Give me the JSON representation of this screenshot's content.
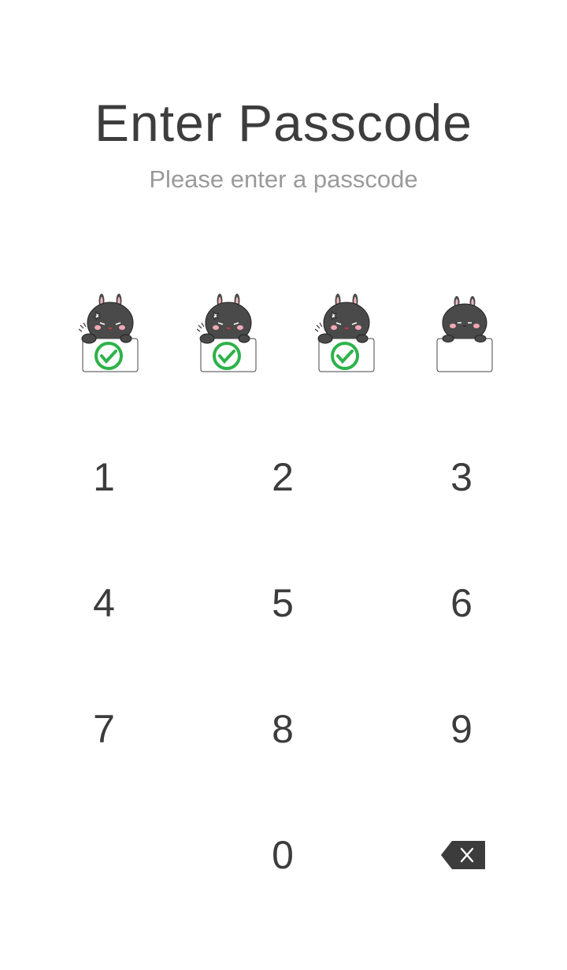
{
  "header": {
    "title": "Enter Passcode",
    "subtitle": "Please enter a passcode"
  },
  "passcode": {
    "length": 4,
    "entered": 3,
    "filled_icon": "bunny-holding-check-sign-icon",
    "empty_icon": "bunny-holding-blank-sign-icon",
    "check_color": "#2db24a"
  },
  "keypad": {
    "keys": [
      "1",
      "2",
      "3",
      "4",
      "5",
      "6",
      "7",
      "8",
      "9",
      "",
      "0",
      "backspace"
    ],
    "backspace_icon": "backspace-icon"
  },
  "colors": {
    "text": "#3c3c3c",
    "subtitle": "#9a9a9a",
    "bunny": "#4a4a4a"
  }
}
